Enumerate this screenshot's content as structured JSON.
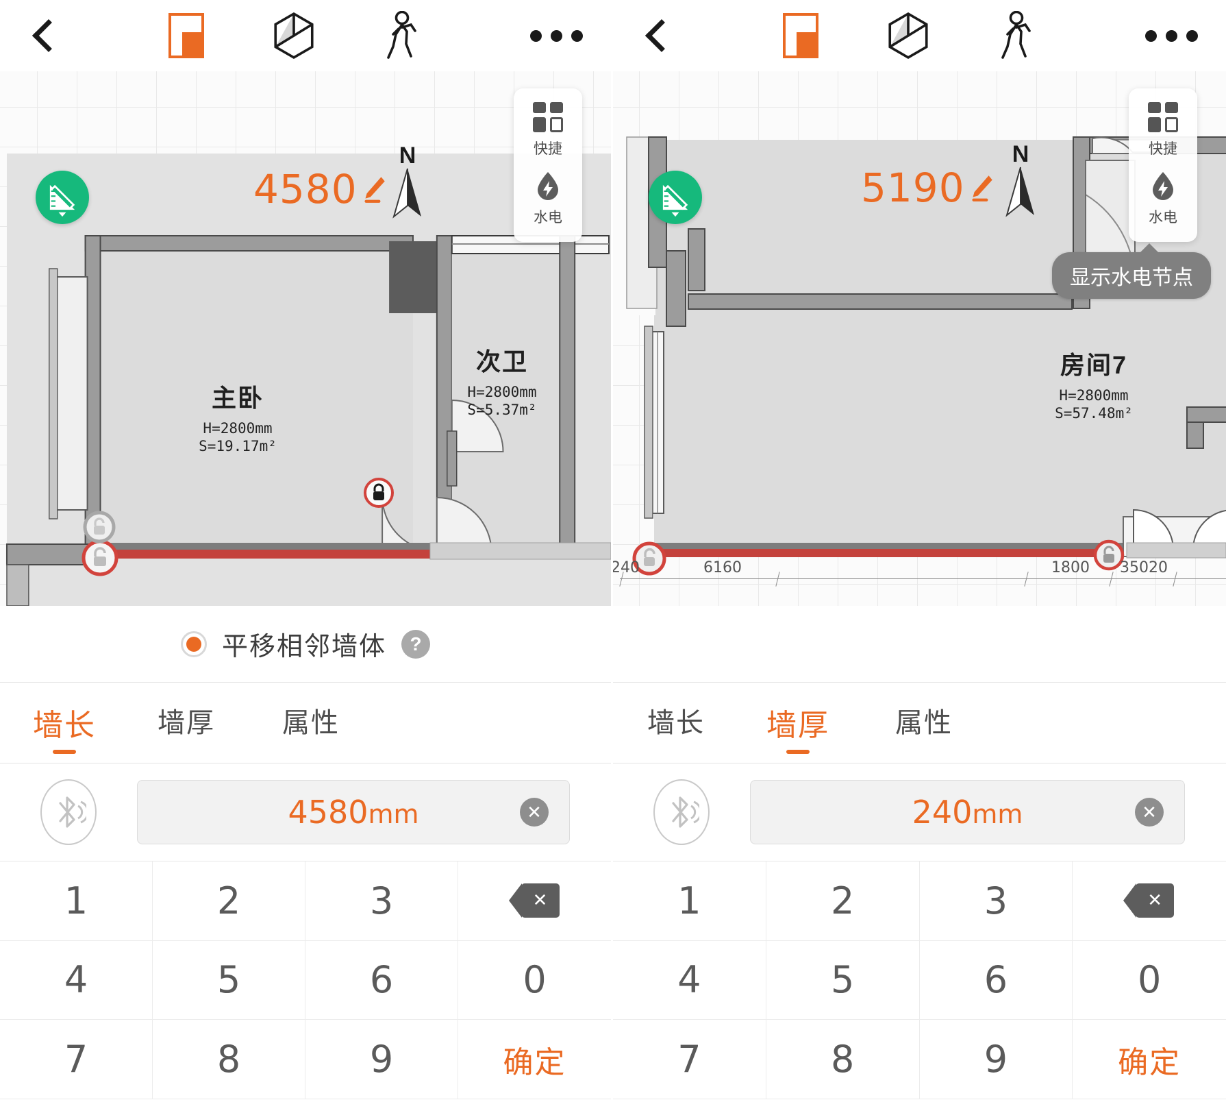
{
  "app": {
    "accent": "#ea6a23",
    "green": "#16b97c",
    "wall_highlight": "#d0453f"
  },
  "panels": [
    {
      "id": "left",
      "toolbar": {
        "back_icon": "chevron-left-icon",
        "view_2d_icon": "plan-2d-icon",
        "view_3d_icon": "cube-3d-icon",
        "walkthrough_icon": "walking-person-icon",
        "more_icon": "more-options-icon"
      },
      "canvas": {
        "measure_fab_icon": "ruler-triangle-icon",
        "dimension_label": "4580",
        "dimension_edit_icon": "pencil-icon",
        "compass_label": "N",
        "quick_panel": [
          {
            "icon": "grid-squares-icon",
            "label": "快捷"
          },
          {
            "icon": "water-drop-bolt-icon",
            "label": "水电"
          }
        ],
        "tooltip": null,
        "rooms": [
          {
            "name": "主卧",
            "height": "H=2800mm",
            "area": "S=19.17m²"
          },
          {
            "name": "次卫",
            "height": "H=2800mm",
            "area": "S=5.37m²"
          }
        ],
        "handles": [
          {
            "name": "wall-handle-unlocked-left",
            "state": "unlocked"
          },
          {
            "name": "wall-handle-locked-right",
            "state": "locked"
          },
          {
            "name": "wall-handle-secondary",
            "state": "unlocked"
          }
        ],
        "ruler": null
      },
      "option": {
        "label": "平移相邻墙体",
        "selected": true,
        "help_label": "?"
      },
      "tabs": [
        {
          "label": "墙长",
          "active": true
        },
        {
          "label": "墙厚",
          "active": false
        },
        {
          "label": "属性",
          "active": false
        }
      ],
      "input": {
        "bluetooth_icon": "bluetooth-measure-icon",
        "value": "4580",
        "unit": "mm",
        "placeholder": "4580mm",
        "clear_icon": "clear-x-icon"
      },
      "keypad": {
        "keys": [
          "1",
          "2",
          "3",
          "backspace",
          "4",
          "5",
          "6",
          "0",
          "7",
          "8",
          "9",
          "确定"
        ],
        "backspace_icon": "backspace-icon",
        "confirm_label": "确定"
      }
    },
    {
      "id": "right",
      "toolbar": {
        "back_icon": "chevron-left-icon",
        "view_2d_icon": "plan-2d-icon",
        "view_3d_icon": "cube-3d-icon",
        "walkthrough_icon": "walking-person-icon",
        "more_icon": "more-options-icon"
      },
      "canvas": {
        "measure_fab_icon": "ruler-triangle-icon",
        "dimension_label": "5190",
        "dimension_edit_icon": "pencil-icon",
        "compass_label": "N",
        "quick_panel": [
          {
            "icon": "grid-squares-icon",
            "label": "快捷"
          },
          {
            "icon": "water-drop-bolt-icon",
            "label": "水电"
          }
        ],
        "tooltip": "显示水电节点",
        "rooms": [
          {
            "name": "房间7",
            "height": "H=2800mm",
            "area": "S=57.48m²"
          }
        ],
        "handles": [
          {
            "name": "wall-handle-unlocked-left",
            "state": "unlocked"
          },
          {
            "name": "wall-handle-locked-right",
            "state": "locked"
          }
        ],
        "ruler": {
          "segments": [
            "240",
            "6160",
            "1800",
            "350",
            "20"
          ]
        }
      },
      "option": null,
      "tabs": [
        {
          "label": "墙长",
          "active": false
        },
        {
          "label": "墙厚",
          "active": true
        },
        {
          "label": "属性",
          "active": false
        }
      ],
      "input": {
        "bluetooth_icon": "bluetooth-measure-icon",
        "value": "240",
        "unit": "mm",
        "placeholder": "240mm",
        "clear_icon": "clear-x-icon"
      },
      "keypad": {
        "keys": [
          "1",
          "2",
          "3",
          "backspace",
          "4",
          "5",
          "6",
          "0",
          "7",
          "8",
          "9",
          "确定"
        ],
        "backspace_icon": "backspace-icon",
        "confirm_label": "确定"
      }
    }
  ]
}
